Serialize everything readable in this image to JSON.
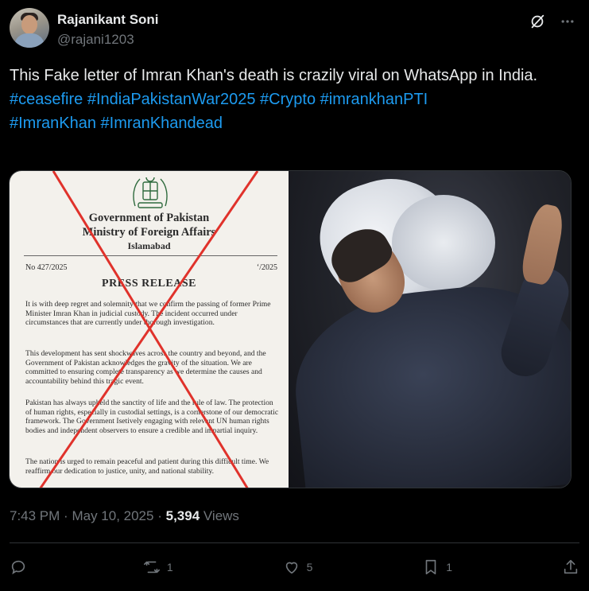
{
  "author": {
    "display_name": "Rajanikant Soni",
    "handle": "@rajani1203"
  },
  "header_icons": [
    "grok-icon",
    "more-icon"
  ],
  "tweet": {
    "text": "This Fake letter of Imran Khan's death is crazily viral on WhatsApp in India.",
    "hashtags": [
      "#ceasefire",
      "#IndiaPakistanWar2025",
      "#Crypto",
      "#imrankhanPTI",
      "#ImranKhan",
      "#ImranKhandead"
    ]
  },
  "letter": {
    "government": "Government of Pakistan",
    "ministry": "Ministry of Foreign Affairs",
    "city": "Islamabad",
    "ref_no": "No 427/2025",
    "date": "‘/2025",
    "heading": "PRESS RELEASE",
    "para1": "It is with deep regret and solemnity that we confirm the passing of former Prime Minister Imran Khan in judicial custody. The incident occurred under circumstances that are currently under thorough investigation.",
    "para2": "This development has sent shockwaves across the country and beyond, and the Government of Pakistan acknowledges the gravity of the situation. We are committed to ensuring complete transparency as we determine the causes and accountability behind this tragic event.",
    "para3": "Pakistan has always upheld the sanctity of life and the rule of law. The protection of human rights, especially in custodial settings, is a cornerstone of our democratic framework. The Government Isetively engaging with relevant UN human rights bodies and independent observers to ensure a credible and impartial inquiry.",
    "para4": "The nation is urged to remain peaceful and patient during this difficult time. We reaffirm our dedication to justice, unity, and national stability."
  },
  "meta": {
    "time": "7:43 PM",
    "separator": "·",
    "date": "May 10, 2025",
    "views_count": "5,394",
    "views_label": "Views"
  },
  "actions": {
    "reply_count": "",
    "repost_count": "1",
    "like_count": "5",
    "bookmark_count": "1"
  },
  "colors": {
    "background": "#000000",
    "text": "#e7e9ea",
    "muted": "#71767b",
    "link": "#1d9bf0",
    "border": "#2f3336",
    "cross": "#e0322b"
  }
}
